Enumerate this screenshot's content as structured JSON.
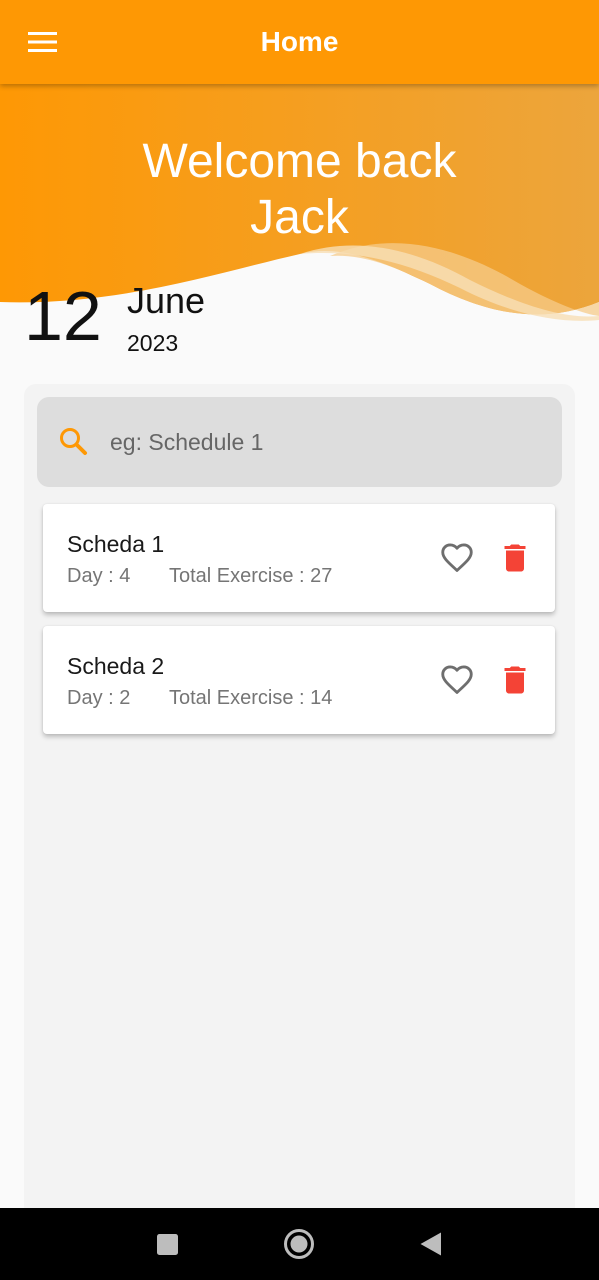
{
  "appbar": {
    "title": "Home",
    "menu_icon": "hamburger-menu-icon",
    "background_color": "#fe9804"
  },
  "header": {
    "welcome_line1": "Welcome back",
    "welcome_line2": "Jack"
  },
  "date": {
    "day": "12",
    "month": "June",
    "year": "2023"
  },
  "search": {
    "placeholder": "eg: Schedule 1",
    "icon": "search-icon",
    "icon_color": "#fe9804"
  },
  "schedules": [
    {
      "title": "Scheda 1",
      "day_text": "Day : 4",
      "exercise_text": "Total Exercise : 27",
      "favorite_icon": "heart-outline-icon",
      "delete_icon": "trash-icon"
    },
    {
      "title": "Scheda 2",
      "day_text": "Day : 2",
      "exercise_text": "Total Exercise : 14",
      "favorite_icon": "heart-outline-icon",
      "delete_icon": "trash-icon"
    }
  ],
  "colors": {
    "accent": "#fe9804",
    "delete": "#f44336",
    "favorite": "#6e6e6e"
  },
  "system_nav": {
    "recent_icon": "square-recent-apps-icon",
    "home_icon": "circle-home-icon",
    "back_icon": "triangle-back-icon"
  }
}
